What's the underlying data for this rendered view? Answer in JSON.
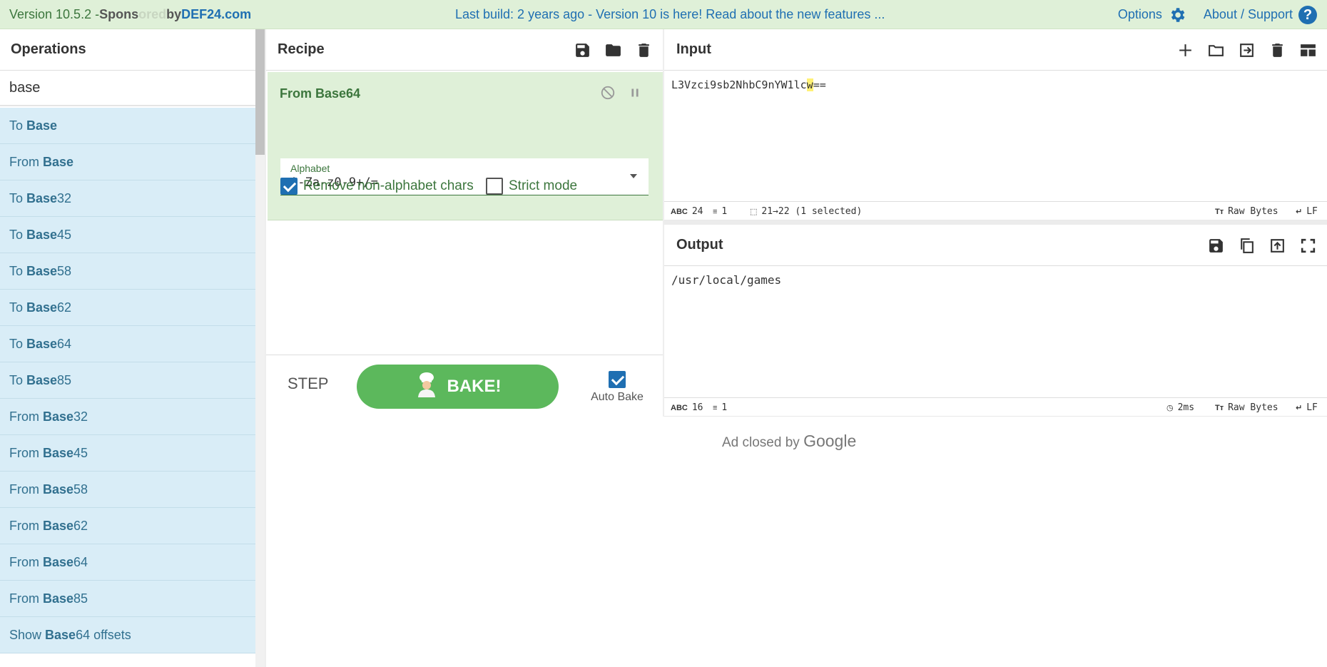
{
  "banner": {
    "version": "Version 10.5.2 - ",
    "sponsored_a": "Spons",
    "sponsored_fade": "ored",
    "sponsored_by": " by ",
    "sponsor": "DEF24.com",
    "notice": "Last build: 2 years ago - Version 10 is here! Read about the new features ...",
    "options": "Options",
    "about": "About / Support",
    "help_glyph": "?"
  },
  "operations": {
    "title": "Operations",
    "search_value": "base",
    "items": [
      {
        "pre": "To ",
        "match": "Base",
        "post": ""
      },
      {
        "pre": "From ",
        "match": "Base",
        "post": ""
      },
      {
        "pre": "To ",
        "match": "Base",
        "post": "32"
      },
      {
        "pre": "To ",
        "match": "Base",
        "post": "45"
      },
      {
        "pre": "To ",
        "match": "Base",
        "post": "58"
      },
      {
        "pre": "To ",
        "match": "Base",
        "post": "62"
      },
      {
        "pre": "To ",
        "match": "Base",
        "post": "64"
      },
      {
        "pre": "To ",
        "match": "Base",
        "post": "85"
      },
      {
        "pre": "From ",
        "match": "Base",
        "post": "32"
      },
      {
        "pre": "From ",
        "match": "Base",
        "post": "45"
      },
      {
        "pre": "From ",
        "match": "Base",
        "post": "58"
      },
      {
        "pre": "From ",
        "match": "Base",
        "post": "62"
      },
      {
        "pre": "From ",
        "match": "Base",
        "post": "64"
      },
      {
        "pre": "From ",
        "match": "Base",
        "post": "85"
      },
      {
        "pre": "Show ",
        "match": "Base",
        "post": "64 offsets"
      }
    ]
  },
  "recipe": {
    "title": "Recipe",
    "op_name": "From Base64",
    "alphabet_label": "Alphabet",
    "alphabet_value": "A-Za-z0-9+/=",
    "remove_label": "Remove non-alphabet chars",
    "remove_checked": true,
    "strict_label": "Strict mode",
    "strict_checked": false,
    "step_label": "STEP",
    "bake_label": "BAKE!",
    "autobake_label": "Auto Bake",
    "autobake_checked": true
  },
  "input": {
    "title": "Input",
    "text_before": "L3Vzci9sb2NhbC9nYW1lc",
    "text_selected": "w",
    "text_after": "==",
    "length": "24",
    "lines": "1",
    "selection": "21→22 (1 selected)",
    "encoding": "Raw Bytes",
    "eol": "LF"
  },
  "output": {
    "title": "Output",
    "text": "/usr/local/games",
    "length": "16",
    "lines": "1",
    "time": "2ms",
    "encoding": "Raw Bytes",
    "eol": "LF"
  },
  "ad": {
    "text": "Ad closed by ",
    "brand": "Google"
  },
  "colors": {
    "accent": "#1f6fb2",
    "recipe_bg": "#dff0d8",
    "op_bg": "#d9edf7",
    "bake": "#5cb85c"
  }
}
